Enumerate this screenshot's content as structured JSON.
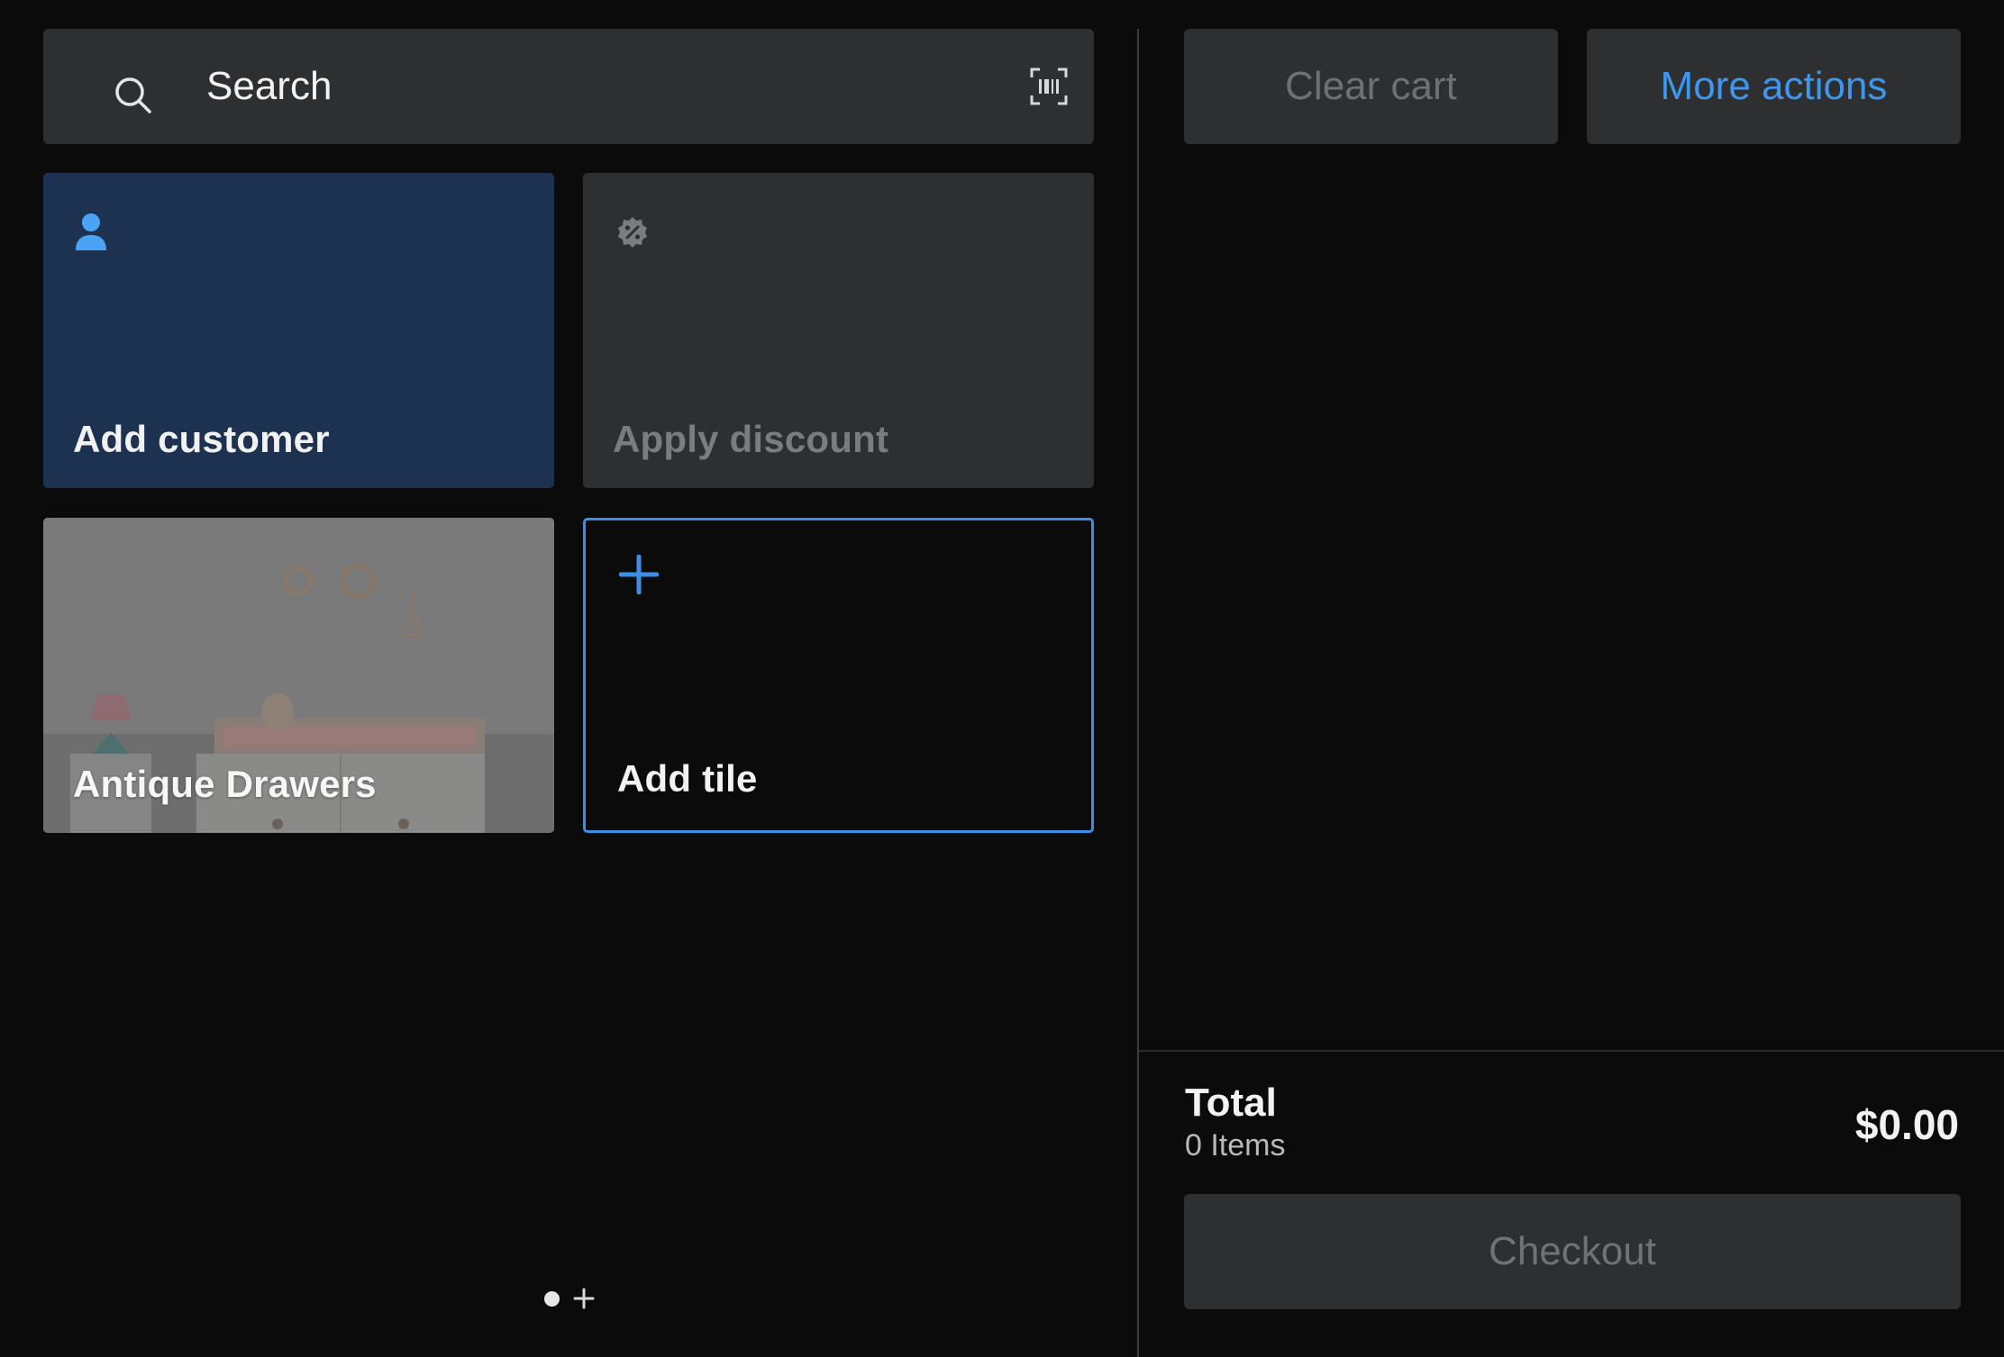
{
  "search": {
    "placeholder": "Search"
  },
  "tiles": [
    {
      "label": "Add customer",
      "icon": "person-icon",
      "color": "#1c3250"
    },
    {
      "label": "Apply discount",
      "icon": "discount-icon",
      "color": "#2e2f31"
    },
    {
      "label": "Antique Drawers",
      "icon": "",
      "color": "#6c6c6c"
    },
    {
      "label": "Add tile",
      "icon": "plus-icon",
      "color": "#3d8fe6"
    }
  ],
  "pager": {
    "current_page": 1,
    "pages": 1
  },
  "cart": {
    "clear_label": "Clear cart",
    "more_label": "More actions",
    "total_label": "Total",
    "items_label": "0 Items",
    "total_amount": "$0.00",
    "checkout_label": "Checkout"
  },
  "colors": {
    "background": "#0b0b0b",
    "surface": "#2e2f31",
    "accent": "#3d97ef",
    "customer_tile": "#1c3250"
  }
}
